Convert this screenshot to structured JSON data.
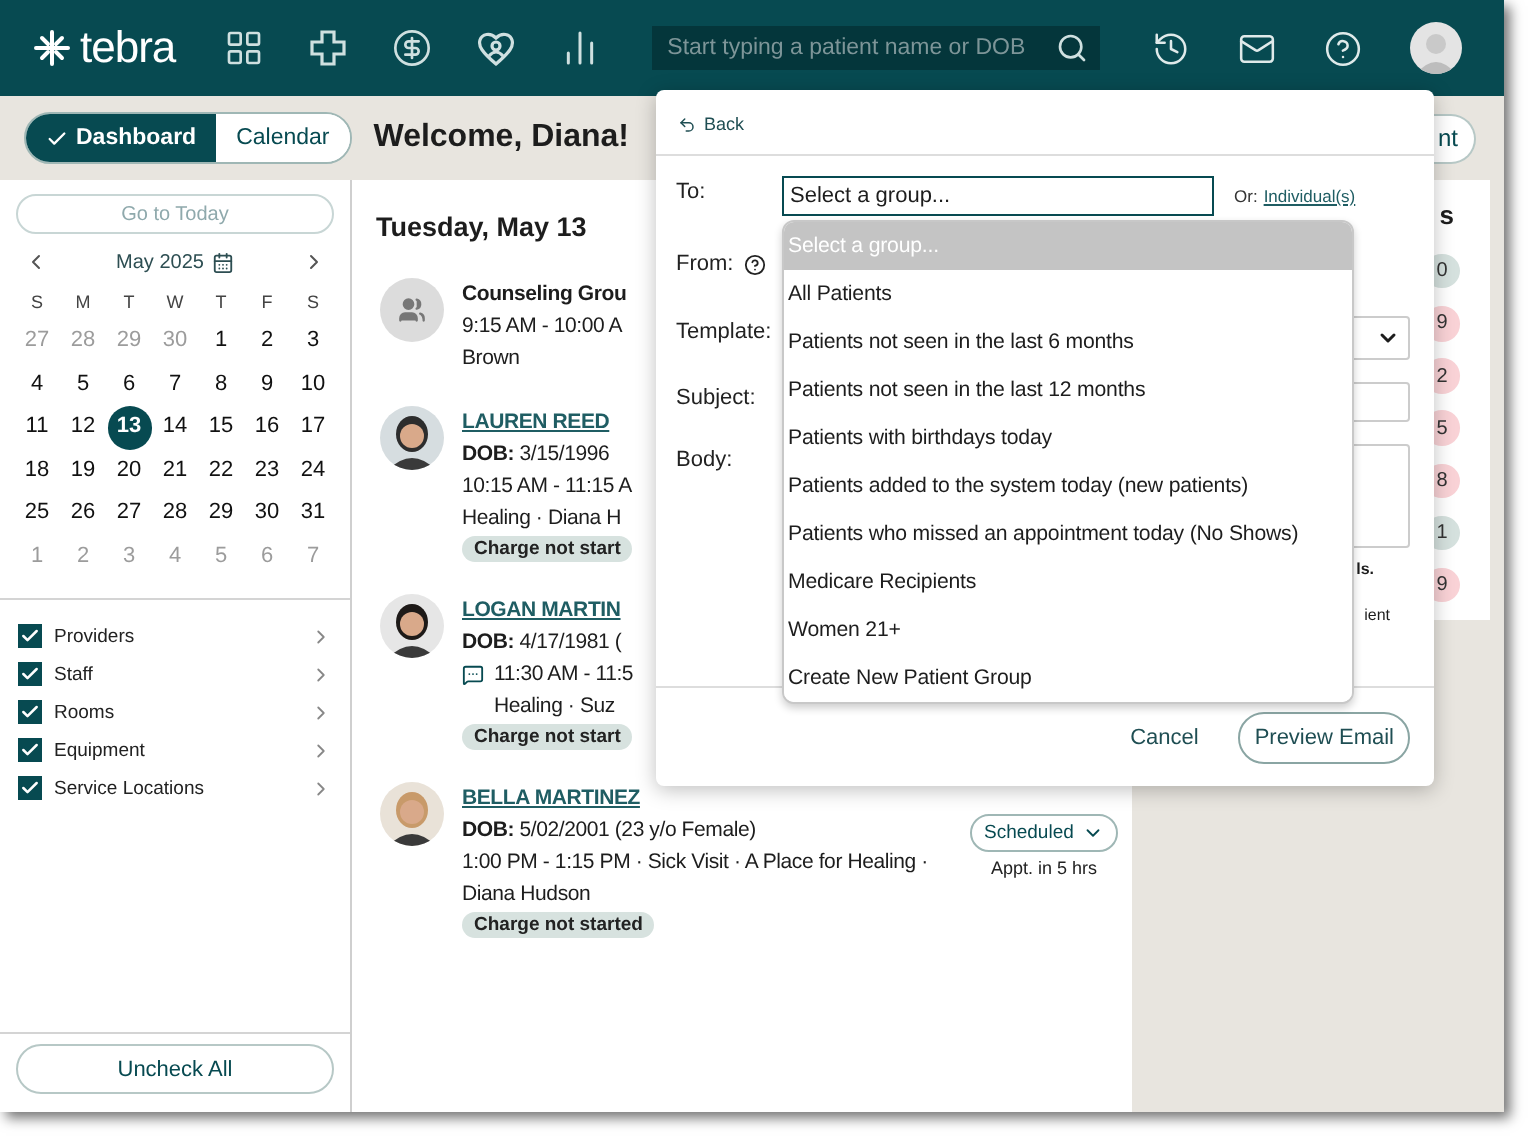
{
  "top_bar": {
    "logo": "tebra",
    "search": {
      "placeholder": "Start typing a patient name or DOB"
    }
  },
  "view_toggle": [
    {
      "label": "Dashboard",
      "selected": true
    },
    {
      "label": "Calendar",
      "selected": false
    }
  ],
  "greeting": "Welcome, Diana!",
  "header_button": "nt",
  "calendar": {
    "today_button": "Go to Today",
    "month": "May 2025",
    "weekdays": [
      "S",
      "M",
      "T",
      "W",
      "T",
      "F",
      "S"
    ],
    "weeks": [
      [
        {
          "label": "27",
          "muted": true,
          "selected": false
        },
        {
          "label": "28",
          "muted": true,
          "selected": false
        },
        {
          "label": "29",
          "muted": true,
          "selected": false
        },
        {
          "label": "30",
          "muted": true,
          "selected": false
        },
        {
          "label": "1",
          "muted": false,
          "selected": false
        },
        {
          "label": "2",
          "muted": false,
          "selected": false
        },
        {
          "label": "3",
          "muted": false,
          "selected": false
        }
      ],
      [
        {
          "label": "4",
          "muted": false,
          "selected": false
        },
        {
          "label": "5",
          "muted": false,
          "selected": false
        },
        {
          "label": "6",
          "muted": false,
          "selected": false
        },
        {
          "label": "7",
          "muted": false,
          "selected": false
        },
        {
          "label": "8",
          "muted": false,
          "selected": false
        },
        {
          "label": "9",
          "muted": false,
          "selected": false
        },
        {
          "label": "10",
          "muted": false,
          "selected": false
        }
      ],
      [
        {
          "label": "11",
          "muted": false,
          "selected": false
        },
        {
          "label": "12",
          "muted": false,
          "selected": false
        },
        {
          "label": "13",
          "muted": false,
          "selected": true
        },
        {
          "label": "14",
          "muted": false,
          "selected": false
        },
        {
          "label": "15",
          "muted": false,
          "selected": false
        },
        {
          "label": "16",
          "muted": false,
          "selected": false
        },
        {
          "label": "17",
          "muted": false,
          "selected": false
        }
      ],
      [
        {
          "label": "18",
          "muted": false,
          "selected": false
        },
        {
          "label": "19",
          "muted": false,
          "selected": false
        },
        {
          "label": "20",
          "muted": false,
          "selected": false
        },
        {
          "label": "21",
          "muted": false,
          "selected": false
        },
        {
          "label": "22",
          "muted": false,
          "selected": false
        },
        {
          "label": "23",
          "muted": false,
          "selected": false
        },
        {
          "label": "24",
          "muted": false,
          "selected": false
        }
      ],
      [
        {
          "label": "25",
          "muted": false,
          "selected": false
        },
        {
          "label": "26",
          "muted": false,
          "selected": false
        },
        {
          "label": "27",
          "muted": false,
          "selected": false
        },
        {
          "label": "28",
          "muted": false,
          "selected": false
        },
        {
          "label": "29",
          "muted": false,
          "selected": false
        },
        {
          "label": "30",
          "muted": false,
          "selected": false
        },
        {
          "label": "31",
          "muted": false,
          "selected": false
        }
      ],
      [
        {
          "label": "1",
          "muted": true,
          "selected": false
        },
        {
          "label": "2",
          "muted": true,
          "selected": false
        },
        {
          "label": "3",
          "muted": true,
          "selected": false
        },
        {
          "label": "4",
          "muted": true,
          "selected": false
        },
        {
          "label": "5",
          "muted": true,
          "selected": false
        },
        {
          "label": "6",
          "muted": true,
          "selected": false
        },
        {
          "label": "7",
          "muted": true,
          "selected": false
        }
      ]
    ]
  },
  "filters": [
    {
      "label": "Providers",
      "checked": true
    },
    {
      "label": "Staff",
      "checked": true
    },
    {
      "label": "Rooms",
      "checked": true
    },
    {
      "label": "Equipment",
      "checked": true
    },
    {
      "label": "Service Locations",
      "checked": true
    }
  ],
  "uncheck_all": "Uncheck All",
  "day_heading": "Tuesday, May 13",
  "appointments": [
    {
      "kind": "group",
      "lines": [
        "Counseling Grou",
        "9:15 AM - 10:00 A",
        "Brown"
      ]
    },
    {
      "kind": "patient",
      "name": "LAUREN REED",
      "dob": "**DOB:** 3/15/1996",
      "lines": [
        "10:15 AM - 11:15 A",
        "Healing · Diana H"
      ],
      "has_note": false,
      "charge": "Charge not start"
    },
    {
      "kind": "patient",
      "name": "LOGAN MARTIN",
      "dob": "**DOB:** 4/17/1981 (",
      "lines": [
        "11:30 AM - 11:5",
        "Healing · Suz"
      ],
      "has_note": true,
      "charge": "Charge not start"
    },
    {
      "kind": "patient",
      "name": "BELLA MARTINEZ",
      "dob": "**DOB:** 5/02/2001 (23 y/o Female)",
      "lines": [
        "1:00 PM - 1:15 PM · Sick Visit · A Place for Healing · Diana Hudson"
      ],
      "has_note": false,
      "charge": "Charge not started",
      "status": "Scheduled",
      "eta": "Appt. in 5 hrs"
    }
  ],
  "stats_card": {
    "heading": "s",
    "badges": [
      {
        "label": "0",
        "color": "#d5e1de"
      },
      {
        "label": "9",
        "color": "#f9d2d6"
      },
      {
        "label": "2",
        "color": "#f9d2d6"
      },
      {
        "label": "5",
        "color": "#f9d2d6"
      },
      {
        "label": "8",
        "color": "#f9d2d6"
      },
      {
        "label": "1",
        "color": "#d5e1de"
      },
      {
        "label": "9",
        "color": "#f9d2d6"
      }
    ]
  },
  "email_panel": {
    "back": "Back",
    "to_label": "To:",
    "to_value": "Select a group...",
    "alt_prefix": "Or:",
    "alt_link": "Individual(s)",
    "from_label": "From:",
    "template_label": "Template:",
    "subject_label": "Subject:",
    "body_label": "Body:",
    "notes": [
      "ls.",
      "ient"
    ],
    "cancel": "Cancel",
    "preview": "Preview Email",
    "dropdown": [
      {
        "label": "Select a group...",
        "selected": true
      },
      {
        "label": "All Patients",
        "selected": false
      },
      {
        "label": "Patients not seen in the last 6 months",
        "selected": false
      },
      {
        "label": "Patients not seen in the last 12 months",
        "selected": false
      },
      {
        "label": "Patients with birthdays today",
        "selected": false
      },
      {
        "label": "Patients added to the system today (new patients)",
        "selected": false
      },
      {
        "label": "Patients who missed an appointment today (No Shows)",
        "selected": false
      },
      {
        "label": "Medicare Recipients",
        "selected": false
      },
      {
        "label": "Women 21+",
        "selected": false
      },
      {
        "label": "Create New Patient Group",
        "selected": false
      }
    ]
  }
}
